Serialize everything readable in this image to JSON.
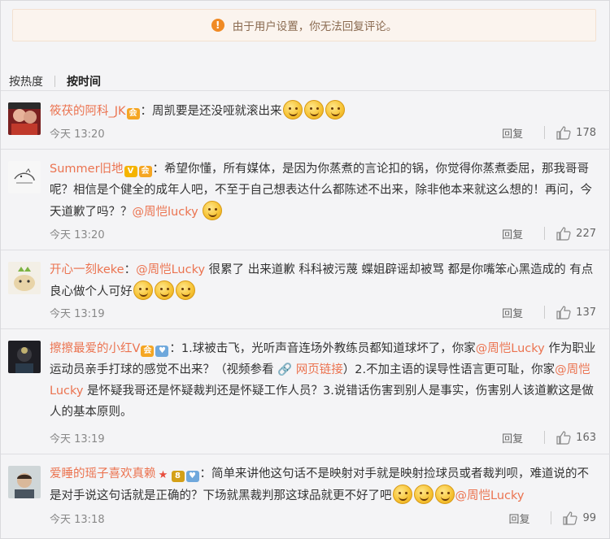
{
  "notice": {
    "icon": "warning-icon",
    "text": "由于用户设置，你无法回复评论。"
  },
  "sort": {
    "hot": "按热度",
    "time": "按时间"
  },
  "comments": [
    {
      "user": "筱茯的阿科_JK",
      "text_parts": [
        "：周凯要是还没哑就滚出来"
      ],
      "time": "今天 13:20",
      "reply": "回复",
      "likes": "178"
    },
    {
      "user": "Summer旧地",
      "text_parts": [
        "：希望你懂，所有媒体，是因为你蒸煮的言论扣的锅，你觉得你蒸煮委屈，那我哥哥呢？相信是个健全的成年人吧，不至于自己想表达什么都陈述不出来，除非他本来就这么想的！再问，今天道歉了吗？？",
        "@周恺lucky"
      ],
      "time": "今天 13:20",
      "reply": "回复",
      "likes": "227"
    },
    {
      "user": "开心一刻keke",
      "text_parts": [
        "：",
        "@周恺Lucky",
        " 很累了 出来道歉 科科被污蔑 蝶姐辟谣却被骂 都是你嘴笨心黑造成的 有点良心做个人可好"
      ],
      "time": "今天 13:19",
      "reply": "回复",
      "likes": "137"
    },
    {
      "user": "擦擦最爱的小红V",
      "text_parts": [
        "：1.球被击飞，光听声音连场外教练员都知道球坏了，你家",
        "@周恺Lucky",
        " 作为职业运动员亲手打球的感觉不出来？（视频参看 ",
        "网页链接",
        "）2.不加主语的误导性语言更可耻，你家",
        "@周恺Lucky",
        " 是怀疑我哥还是怀疑裁判还是怀疑工作人员？3.说错话伤害到别人是事实，伤害别人该道歉这是做人的基本原则。"
      ],
      "time": "今天 13:19",
      "reply": "回复",
      "likes": "163"
    },
    {
      "user": "爱睡的瑶子喜欢真赖",
      "text_parts": [
        "：简单来讲他这句话不是映射对手就是映射捡球员或者裁判呗，难道说的不是对手说这句话就是正确的？下场就黑裁判那这球品就更不好了吧",
        "@周恺Lucky"
      ],
      "time": "今天 13:18",
      "reply": "回复",
      "likes": "99"
    }
  ]
}
